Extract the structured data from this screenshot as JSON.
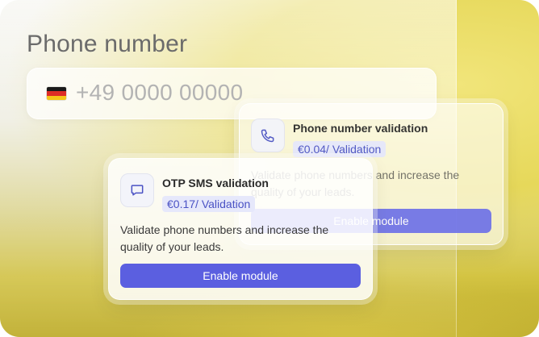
{
  "field_label": "Phone number",
  "phone_input": {
    "flag_icon": "germany-flag-icon",
    "placeholder": "+49 0000 00000"
  },
  "cards": {
    "phone_validation": {
      "icon": "phone-icon",
      "title": "Phone number validation",
      "price": "€0.04/ Validation",
      "description": "Validate phone numbers and increase the quality of your leads.",
      "button": "Enable module"
    },
    "otp_sms": {
      "icon": "chat-bubble-icon",
      "title": "OTP SMS validation",
      "price": "€0.17/ Validation",
      "description": "Validate phone numbers and increase the quality of your leads.",
      "button": "Enable module"
    }
  },
  "colors": {
    "accent": "#5b5fe0",
    "price_badge_bg": "#e6e8fb",
    "price_badge_text": "#4a52c4",
    "background_yellow": "#d7cf83"
  }
}
